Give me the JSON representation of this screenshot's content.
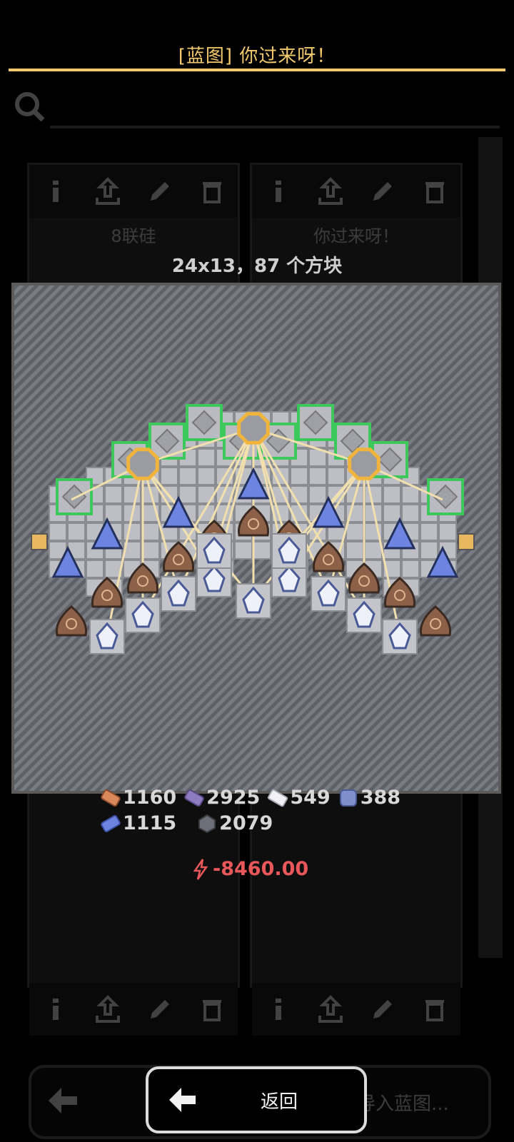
{
  "dialog": {
    "title": "[蓝图] 你过来呀！",
    "dimensions": "24x13，87 个方块",
    "accent_color": "#f3c96e"
  },
  "requirements": {
    "row1": [
      {
        "icon": "copper-icon",
        "amount": "1160",
        "color": "#d9885c"
      },
      {
        "icon": "lead-icon",
        "amount": "2925",
        "color": "#8f7bbf"
      },
      {
        "icon": "metaglass-icon",
        "amount": "549",
        "color": "#e8e8ee"
      },
      {
        "icon": "titanium-icon",
        "amount": "388",
        "color": "#7f8fcc"
      }
    ],
    "row2": [
      {
        "icon": "plastanium-icon",
        "amount": "1115",
        "color": "#6d85e0"
      },
      {
        "icon": "silicon-icon",
        "amount": "2079",
        "color": "#6d6f78"
      }
    ],
    "power": "-8460.00",
    "power_color": "#e8575a"
  },
  "background": {
    "cards": [
      {
        "name": "8联硅"
      },
      {
        "name": "你过来呀！"
      }
    ],
    "import_label": "导入蓝图..."
  },
  "buttons": {
    "back_label": "返回"
  }
}
